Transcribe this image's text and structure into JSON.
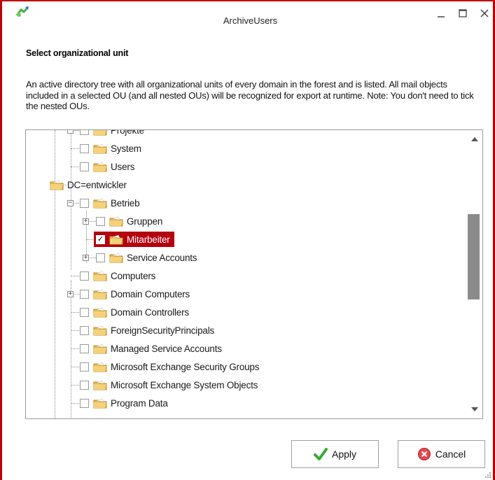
{
  "window": {
    "title": "ArchiveUsers",
    "border_color": "#c00000",
    "controls": [
      "minimize-icon",
      "maximize-icon",
      "close-icon"
    ]
  },
  "heading": "Select organizational unit",
  "description": "An active directory tree with all organizational units of every domain in the forest and is listed. All mail objects included in a selected OU (and all nested OUs) will be recognized for export at runtime. Note: You don't need to tick the nested OUs.",
  "tree": {
    "nodes": [
      {
        "label": "Projekte",
        "checked": false,
        "expanded": true
      },
      {
        "label": "System",
        "checked": false
      },
      {
        "label": "Users",
        "checked": false
      },
      {
        "label": "DC=entwickler",
        "expanded": true
      },
      {
        "label": "Betrieb",
        "checked": false,
        "expanded": true
      },
      {
        "label": "Gruppen",
        "checked": false,
        "expanded": false
      },
      {
        "label": "Mitarbeiter",
        "checked": true,
        "selected": true
      },
      {
        "label": "Service Accounts",
        "checked": false,
        "expanded": false
      },
      {
        "label": "Computers",
        "checked": false
      },
      {
        "label": "Domain Computers",
        "checked": false,
        "expanded": false
      },
      {
        "label": "Domain Controllers",
        "checked": false
      },
      {
        "label": "ForeignSecurityPrincipals",
        "checked": false
      },
      {
        "label": "Managed Service Accounts",
        "checked": false
      },
      {
        "label": "Microsoft Exchange Security Groups",
        "checked": false
      },
      {
        "label": "Microsoft Exchange System Objects",
        "checked": false
      },
      {
        "label": "Program Data",
        "checked": false
      }
    ],
    "selection_color": "#b5000d",
    "scroll_position": 0.31
  },
  "buttons": {
    "apply": "Apply",
    "cancel": "Cancel"
  }
}
